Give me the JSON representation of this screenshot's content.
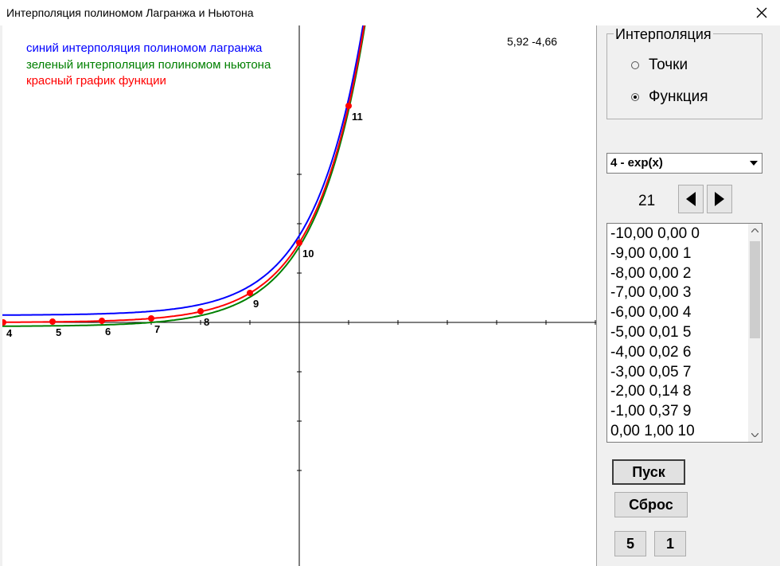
{
  "window": {
    "title": "Интерполяция полиномом Лагранжа и Ньютона",
    "close_icon": "close-icon"
  },
  "plot": {
    "coord_readout": "5,92 -4,66",
    "legend": [
      {
        "text": "синий интерполяция полиномом лагранжа",
        "color": "#0000ff"
      },
      {
        "text": "зеленый интерполяция полиномом ньютона",
        "color": "#008000"
      },
      {
        "text": "красный график функции",
        "color": "#ff0000"
      }
    ],
    "colors": {
      "lagrange": "#0000ff",
      "newton": "#008000",
      "function": "#ff0000",
      "axes": "#000000"
    }
  },
  "chart_data": {
    "type": "line",
    "title": "",
    "xlabel": "",
    "ylabel": "",
    "grid": false,
    "points": [
      {
        "label": "4",
        "x": -6,
        "y": 0.0
      },
      {
        "label": "5",
        "x": -5,
        "y": 0.01
      },
      {
        "label": "6",
        "x": -4,
        "y": 0.02
      },
      {
        "label": "7",
        "x": -3,
        "y": 0.05
      },
      {
        "label": "8",
        "x": -2,
        "y": 0.14
      },
      {
        "label": "9",
        "x": -1,
        "y": 0.37
      },
      {
        "label": "10",
        "x": 0,
        "y": 1.0
      },
      {
        "label": "11",
        "x": 1,
        "y": 2.72
      }
    ],
    "series": [
      {
        "name": "синий интерполяция полиномом лагранжа",
        "color": "#0000ff"
      },
      {
        "name": "зеленый интерполяция полиномом ньютона",
        "color": "#008000"
      },
      {
        "name": "красный график функции",
        "color": "#ff0000"
      }
    ]
  },
  "panel": {
    "group_title": "Интерполяция",
    "radio_points": "Точки",
    "radio_function": "Функция",
    "selected_mode": "Функция",
    "function_select": "4 - exp(x)",
    "count": "21",
    "prev_icon": "triangle-left-icon",
    "next_icon": "triangle-right-icon",
    "list": [
      "-10,00 0,00 0",
      "-9,00 0,00 1",
      "-8,00 0,00 2",
      "-7,00 0,00 3",
      "-6,00 0,00 4",
      "-5,00 0,01 5",
      "-4,00 0,02 6",
      "-3,00 0,05 7",
      "-2,00 0,14 8",
      "-1,00 0,37 9",
      "0,00 1,00 10"
    ],
    "start_button": "Пуск",
    "reset_button": "Сброс",
    "btn_5": "5",
    "btn_1": "1"
  }
}
